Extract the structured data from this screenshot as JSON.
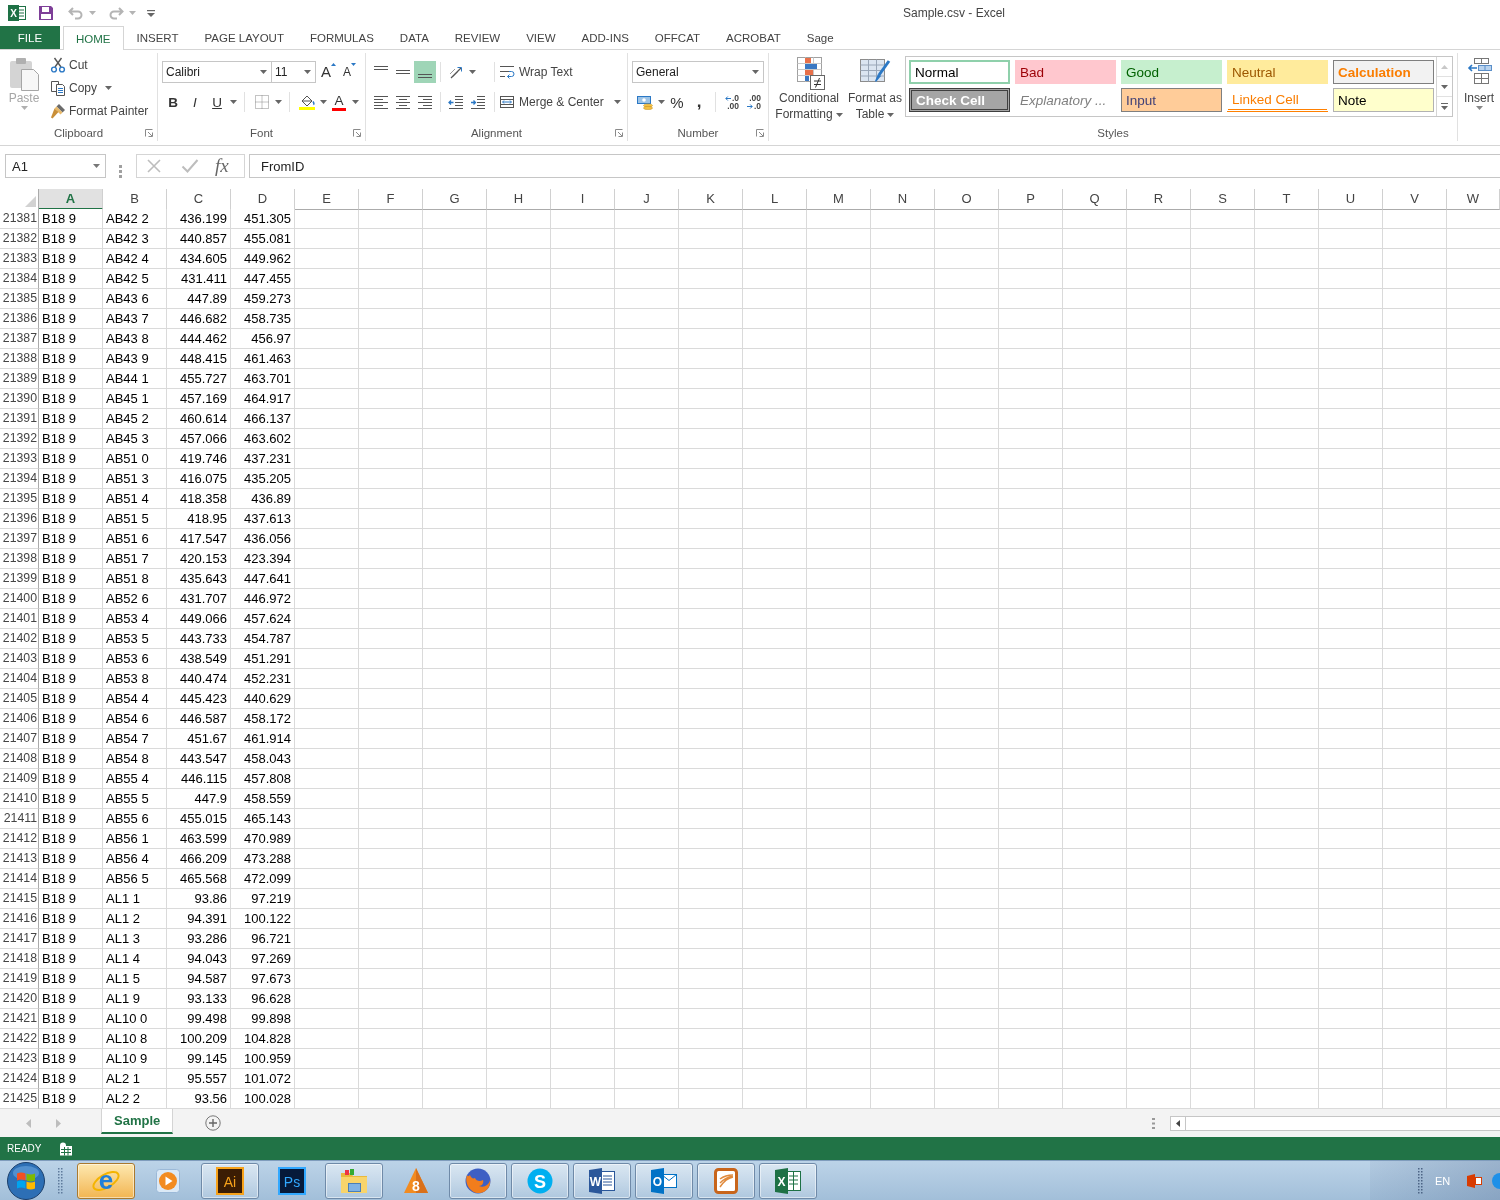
{
  "title_bar": {
    "app_glyph": "X",
    "quick_access": [
      {
        "kind": "save",
        "disabled": false
      },
      {
        "kind": "undo",
        "disabled": true
      },
      {
        "kind": "redo",
        "disabled": true
      }
    ],
    "title": "Sample.csv - Excel"
  },
  "tabs": [
    {
      "label": "FILE",
      "kind": "file",
      "selected": false
    },
    {
      "label": "HOME",
      "kind": "tab",
      "selected": true
    },
    {
      "label": "INSERT",
      "kind": "tab",
      "selected": false
    },
    {
      "label": "PAGE LAYOUT",
      "kind": "tab",
      "selected": false
    },
    {
      "label": "FORMULAS",
      "kind": "tab",
      "selected": false
    },
    {
      "label": "DATA",
      "kind": "tab",
      "selected": false
    },
    {
      "label": "REVIEW",
      "kind": "tab",
      "selected": false
    },
    {
      "label": "VIEW",
      "kind": "tab",
      "selected": false
    },
    {
      "label": "ADD-INS",
      "kind": "tab",
      "selected": false
    },
    {
      "label": "OFFCAT",
      "kind": "tab",
      "selected": false
    },
    {
      "label": "ACROBAT",
      "kind": "tab",
      "selected": false
    },
    {
      "label": "Sage",
      "kind": "tab",
      "selected": false
    }
  ],
  "ribbon": {
    "clipboard": {
      "label": "Clipboard",
      "paste": {
        "label": "Paste",
        "disabled": true
      },
      "cut": "Cut",
      "copy": "Copy",
      "format_painter": "Format Painter"
    },
    "font": {
      "label": "Font",
      "font_name": "Calibri",
      "font_size": "11",
      "grow_font": "A",
      "shrink_font": "A",
      "bold": "B",
      "italic": "I",
      "underline": "U",
      "font_color": "A"
    },
    "alignment": {
      "label": "Alignment",
      "vertical": [
        {
          "kind": "top",
          "selected": false
        },
        {
          "kind": "middle",
          "selected": false
        },
        {
          "kind": "bottom",
          "selected": true
        }
      ],
      "horizontal": [
        {
          "kind": "left",
          "selected": false
        },
        {
          "kind": "center",
          "selected": false
        },
        {
          "kind": "right",
          "selected": false
        }
      ],
      "wrap_text": "Wrap Text",
      "merge": "Merge & Center"
    },
    "number": {
      "label": "Number",
      "format": "General",
      "percent": "%",
      "comma": ",",
      "decimals": [
        {
          "kind": "increase",
          "lines": [
            ".0",
            ".00"
          ]
        },
        {
          "kind": "decrease",
          "lines": [
            ".00",
            ".0"
          ]
        }
      ]
    },
    "styles": {
      "label": "Styles",
      "conditional_formatting": "Conditional Formatting",
      "format_as_table": "Format as Table",
      "cell_styles": [
        {
          "label": "Normal",
          "kind": "normal",
          "selected": true
        },
        {
          "label": "Bad",
          "kind": "bad",
          "selected": false
        },
        {
          "label": "Good",
          "kind": "good",
          "selected": false
        },
        {
          "label": "Neutral",
          "kind": "neutral",
          "selected": false
        },
        {
          "label": "Calculation",
          "kind": "calculation",
          "selected": false
        },
        {
          "label": "Check Cell",
          "kind": "check",
          "selected": false
        },
        {
          "label": "Explanatory ...",
          "kind": "explanatory",
          "selected": false
        },
        {
          "label": "Input",
          "kind": "input",
          "selected": false
        },
        {
          "label": "Linked Cell",
          "kind": "linked",
          "selected": false
        },
        {
          "label": "Note",
          "kind": "note",
          "selected": false
        }
      ]
    },
    "cells": {
      "insert": "Insert"
    }
  },
  "formula_bar": {
    "name_box": "A1",
    "cancel_disabled": true,
    "enter_disabled": true,
    "function": "fx",
    "value": "FromID"
  },
  "sheet": {
    "columns": [
      {
        "label": "A",
        "selected": true
      },
      {
        "label": "B",
        "selected": false
      },
      {
        "label": "C",
        "selected": false
      },
      {
        "label": "D",
        "selected": false
      },
      {
        "label": "E",
        "selected": false
      },
      {
        "label": "F",
        "selected": false
      },
      {
        "label": "G",
        "selected": false
      },
      {
        "label": "H",
        "selected": false
      },
      {
        "label": "I",
        "selected": false
      },
      {
        "label": "J",
        "selected": false
      },
      {
        "label": "K",
        "selected": false
      },
      {
        "label": "L",
        "selected": false
      },
      {
        "label": "M",
        "selected": false
      },
      {
        "label": "N",
        "selected": false
      },
      {
        "label": "O",
        "selected": false
      },
      {
        "label": "P",
        "selected": false
      },
      {
        "label": "Q",
        "selected": false
      },
      {
        "label": "R",
        "selected": false
      },
      {
        "label": "S",
        "selected": false
      },
      {
        "label": "T",
        "selected": false
      },
      {
        "label": "U",
        "selected": false
      },
      {
        "label": "V",
        "selected": false
      },
      {
        "label": "W",
        "selected": false
      }
    ],
    "rows": [
      {
        "header": "21381",
        "cells": [
          "B18 9",
          "AB42 2",
          "436.199",
          "451.305"
        ]
      },
      {
        "header": "21382",
        "cells": [
          "B18 9",
          "AB42 3",
          "440.857",
          "455.081"
        ]
      },
      {
        "header": "21383",
        "cells": [
          "B18 9",
          "AB42 4",
          "434.605",
          "449.962"
        ]
      },
      {
        "header": "21384",
        "cells": [
          "B18 9",
          "AB42 5",
          "431.411",
          "447.455"
        ]
      },
      {
        "header": "21385",
        "cells": [
          "B18 9",
          "AB43 6",
          "447.89",
          "459.273"
        ]
      },
      {
        "header": "21386",
        "cells": [
          "B18 9",
          "AB43 7",
          "446.682",
          "458.735"
        ]
      },
      {
        "header": "21387",
        "cells": [
          "B18 9",
          "AB43 8",
          "444.462",
          "456.97"
        ]
      },
      {
        "header": "21388",
        "cells": [
          "B18 9",
          "AB43 9",
          "448.415",
          "461.463"
        ]
      },
      {
        "header": "21389",
        "cells": [
          "B18 9",
          "AB44 1",
          "455.727",
          "463.701"
        ]
      },
      {
        "header": "21390",
        "cells": [
          "B18 9",
          "AB45 1",
          "457.169",
          "464.917"
        ]
      },
      {
        "header": "21391",
        "cells": [
          "B18 9",
          "AB45 2",
          "460.614",
          "466.137"
        ]
      },
      {
        "header": "21392",
        "cells": [
          "B18 9",
          "AB45 3",
          "457.066",
          "463.602"
        ]
      },
      {
        "header": "21393",
        "cells": [
          "B18 9",
          "AB51 0",
          "419.746",
          "437.231"
        ]
      },
      {
        "header": "21394",
        "cells": [
          "B18 9",
          "AB51 3",
          "416.075",
          "435.205"
        ]
      },
      {
        "header": "21395",
        "cells": [
          "B18 9",
          "AB51 4",
          "418.358",
          "436.89"
        ]
      },
      {
        "header": "21396",
        "cells": [
          "B18 9",
          "AB51 5",
          "418.95",
          "437.613"
        ]
      },
      {
        "header": "21397",
        "cells": [
          "B18 9",
          "AB51 6",
          "417.547",
          "436.056"
        ]
      },
      {
        "header": "21398",
        "cells": [
          "B18 9",
          "AB51 7",
          "420.153",
          "423.394"
        ]
      },
      {
        "header": "21399",
        "cells": [
          "B18 9",
          "AB51 8",
          "435.643",
          "447.641"
        ]
      },
      {
        "header": "21400",
        "cells": [
          "B18 9",
          "AB52 6",
          "431.707",
          "446.972"
        ]
      },
      {
        "header": "21401",
        "cells": [
          "B18 9",
          "AB53 4",
          "449.066",
          "457.624"
        ]
      },
      {
        "header": "21402",
        "cells": [
          "B18 9",
          "AB53 5",
          "443.733",
          "454.787"
        ]
      },
      {
        "header": "21403",
        "cells": [
          "B18 9",
          "AB53 6",
          "438.549",
          "451.291"
        ]
      },
      {
        "header": "21404",
        "cells": [
          "B18 9",
          "AB53 8",
          "440.474",
          "452.231"
        ]
      },
      {
        "header": "21405",
        "cells": [
          "B18 9",
          "AB54 4",
          "445.423",
          "440.629"
        ]
      },
      {
        "header": "21406",
        "cells": [
          "B18 9",
          "AB54 6",
          "446.587",
          "458.172"
        ]
      },
      {
        "header": "21407",
        "cells": [
          "B18 9",
          "AB54 7",
          "451.67",
          "461.914"
        ]
      },
      {
        "header": "21408",
        "cells": [
          "B18 9",
          "AB54 8",
          "443.547",
          "458.043"
        ]
      },
      {
        "header": "21409",
        "cells": [
          "B18 9",
          "AB55 4",
          "446.115",
          "457.808"
        ]
      },
      {
        "header": "21410",
        "cells": [
          "B18 9",
          "AB55 5",
          "447.9",
          "458.559"
        ]
      },
      {
        "header": "21411",
        "cells": [
          "B18 9",
          "AB55 6",
          "455.015",
          "465.143"
        ]
      },
      {
        "header": "21412",
        "cells": [
          "B18 9",
          "AB56 1",
          "463.599",
          "470.989"
        ]
      },
      {
        "header": "21413",
        "cells": [
          "B18 9",
          "AB56 4",
          "466.209",
          "473.288"
        ]
      },
      {
        "header": "21414",
        "cells": [
          "B18 9",
          "AB56 5",
          "465.568",
          "472.099"
        ]
      },
      {
        "header": "21415",
        "cells": [
          "B18 9",
          "AL1 1",
          "93.86",
          "97.219"
        ]
      },
      {
        "header": "21416",
        "cells": [
          "B18 9",
          "AL1 2",
          "94.391",
          "100.122"
        ]
      },
      {
        "header": "21417",
        "cells": [
          "B18 9",
          "AL1 3",
          "93.286",
          "96.721"
        ]
      },
      {
        "header": "21418",
        "cells": [
          "B18 9",
          "AL1 4",
          "94.043",
          "97.269"
        ]
      },
      {
        "header": "21419",
        "cells": [
          "B18 9",
          "AL1 5",
          "94.587",
          "97.673"
        ]
      },
      {
        "header": "21420",
        "cells": [
          "B18 9",
          "AL1 9",
          "93.133",
          "96.628"
        ]
      },
      {
        "header": "21421",
        "cells": [
          "B18 9",
          "AL10 0",
          "99.498",
          "99.898"
        ]
      },
      {
        "header": "21422",
        "cells": [
          "B18 9",
          "AL10 8",
          "100.209",
          "104.828"
        ]
      },
      {
        "header": "21423",
        "cells": [
          "B18 9",
          "AL10 9",
          "99.145",
          "100.959"
        ]
      },
      {
        "header": "21424",
        "cells": [
          "B18 9",
          "AL2 1",
          "95.557",
          "101.072"
        ]
      },
      {
        "header": "21425",
        "cells": [
          "B18 9",
          "AL2 2",
          "93.56",
          "100.028"
        ]
      }
    ]
  },
  "sheet_tabs": [
    {
      "label": "Sample",
      "selected": true
    }
  ],
  "status_bar": {
    "text": "READY"
  },
  "taskbar": {
    "apps": [
      {
        "kind": "ie",
        "glyph": "e",
        "running": true,
        "highlighted": true
      },
      {
        "kind": "media",
        "running": false,
        "highlighted": false
      },
      {
        "kind": "ai",
        "glyph": "Ai",
        "running": true,
        "highlighted": false
      },
      {
        "kind": "ps",
        "glyph": "Ps",
        "running": false,
        "highlighted": false
      },
      {
        "kind": "explorer",
        "running": true,
        "highlighted": false
      },
      {
        "kind": "cone",
        "glyph": "8",
        "running": false,
        "highlighted": false
      },
      {
        "kind": "firefox",
        "running": true,
        "highlighted": false
      },
      {
        "kind": "skype",
        "glyph": "S",
        "running": true,
        "highlighted": false
      },
      {
        "kind": "word",
        "glyph": "W",
        "running": true,
        "highlighted": false
      },
      {
        "kind": "outlook",
        "glyph": "O",
        "running": true,
        "highlighted": false
      },
      {
        "kind": "frame",
        "running": true,
        "highlighted": false
      },
      {
        "kind": "excel",
        "glyph": "X",
        "running": true,
        "highlighted": false
      }
    ],
    "tray": {
      "language": "EN"
    }
  }
}
